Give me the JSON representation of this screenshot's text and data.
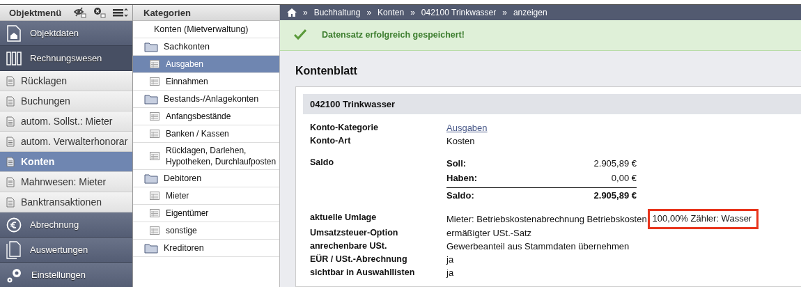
{
  "sidebar": {
    "title": "Objektmenü",
    "items": [
      {
        "label": "Objektdaten",
        "kind": "section",
        "selected": false
      },
      {
        "label": "Rechnungswesen",
        "kind": "section",
        "selected": true
      },
      {
        "label": "Rücklagen",
        "kind": "item",
        "selected": false
      },
      {
        "label": "Buchungen",
        "kind": "item",
        "selected": false
      },
      {
        "label": "autom. Sollst.: Mieter",
        "kind": "item",
        "selected": false
      },
      {
        "label": "autom. Verwalterhonorar",
        "kind": "item",
        "selected": false
      },
      {
        "label": "Konten",
        "kind": "item",
        "selected": true
      },
      {
        "label": "Mahnwesen: Mieter",
        "kind": "item",
        "selected": false
      },
      {
        "label": "Banktransaktionen",
        "kind": "item",
        "selected": false
      },
      {
        "label": "Abrechnung",
        "kind": "section",
        "selected": false
      },
      {
        "label": "Auswertungen",
        "kind": "section",
        "selected": false
      },
      {
        "label": "Einstellungen",
        "kind": "section",
        "selected": false
      }
    ]
  },
  "categories": {
    "title": "Kategorien",
    "root": "Konten (Mietverwaltung)",
    "folders": [
      {
        "label": "Sachkonten",
        "children": [
          {
            "label": "Ausgaben",
            "selected": true
          },
          {
            "label": "Einnahmen",
            "selected": false
          }
        ]
      },
      {
        "label": "Bestands-/Anlagekonten",
        "children": [
          {
            "label": "Anfangsbestände",
            "selected": false
          },
          {
            "label": "Banken / Kassen",
            "selected": false
          },
          {
            "label": "Rücklagen, Darlehen, Hypotheken, Durchlaufposten",
            "selected": false
          }
        ]
      },
      {
        "label": "Debitoren",
        "children": [
          {
            "label": "Mieter",
            "selected": false
          },
          {
            "label": "Eigentümer",
            "selected": false
          },
          {
            "label": "sonstige",
            "selected": false
          }
        ]
      },
      {
        "label": "Kreditoren"
      }
    ]
  },
  "breadcrumb": [
    "Buchhaltung",
    "Konten",
    "042100 Trinkwasser",
    "anzeigen"
  ],
  "breadcrumb_separator": "»",
  "alert": "Datensatz erfolgreich gespeichert!",
  "panel_title": "Kontenblatt",
  "account": {
    "title": "042100 Trinkwasser",
    "fields": [
      {
        "label": "Konto-Kategorie",
        "kind": "link",
        "value": "Ausgaben"
      },
      {
        "label": "Konto-Art",
        "kind": "text",
        "value": "Kosten"
      },
      {
        "label": "Saldo",
        "kind": "balance",
        "rows": [
          {
            "label": "Soll:",
            "amount": "2.905,89 €",
            "total": false
          },
          {
            "label": "Haben:",
            "amount": "0,00 €",
            "total": false
          },
          {
            "label": "Saldo:",
            "amount": "2.905,89 €",
            "total": true
          }
        ]
      },
      {
        "label": "aktuelle Umlage",
        "kind": "parts",
        "parts": [
          {
            "text": "Mieter: Betriebskostenabrechnung Betriebskosten",
            "highlighted": false
          },
          {
            "text": "100,00% Zähler: Wasser",
            "highlighted": true
          }
        ]
      },
      {
        "label": "Umsatzsteuer-Option",
        "kind": "text",
        "value": "ermäßigter USt.-Satz"
      },
      {
        "label": "anrechenbare USt.",
        "kind": "text",
        "value": "Gewerbeanteil aus Stammdaten übernehmen"
      },
      {
        "label": "EÜR / USt.-Abrechnung",
        "kind": "text",
        "value": "ja"
      },
      {
        "label": "sichtbar in Auswahllisten",
        "kind": "text",
        "value": "ja"
      }
    ]
  }
}
